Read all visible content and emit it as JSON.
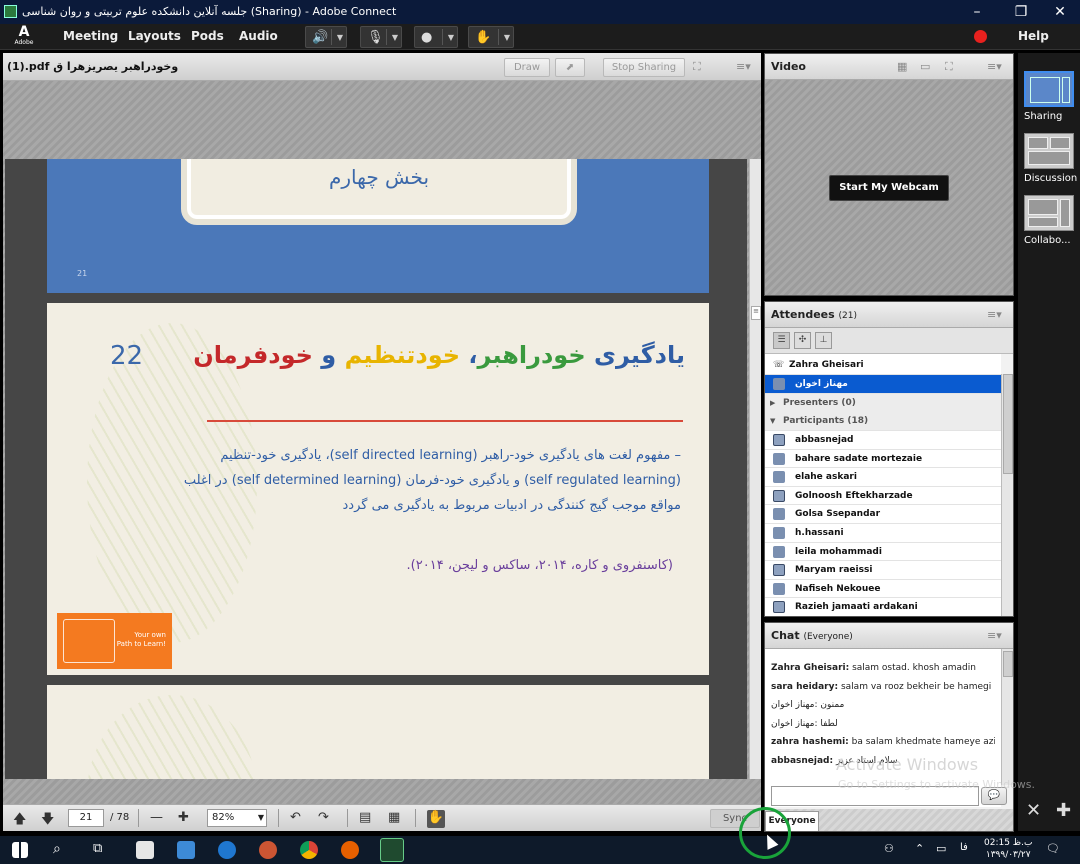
{
  "window": {
    "title": "جلسه آنلاین دانشکده علوم تربیتی و روان شناسی (Sharing) - Adobe Connect",
    "minimize": "–",
    "maximize": "❐",
    "close": "✕"
  },
  "menubar": {
    "logo_text": "Adobe",
    "items": [
      "Meeting",
      "Layouts",
      "Pods",
      "Audio"
    ],
    "help": "Help"
  },
  "share_pod": {
    "filename": "(1).pdf وخودراهبر یصریزهرا ق",
    "draw_button": "Draw",
    "stop_sharing_button": "Stop Sharing",
    "slide21": {
      "title": "بخش چهارم",
      "page_number": "21"
    },
    "slide22": {
      "number": "22",
      "title_parts": [
        {
          "text": "یادگیری ",
          "color": "#2f5da5"
        },
        {
          "text": "خودراهبر",
          "color": "#3a9a3e"
        },
        {
          "text": "، ",
          "color": "#2f5da5"
        },
        {
          "text": "خودتنظیم",
          "color": "#e8b400"
        },
        {
          "text": " و ",
          "color": "#2f5da5"
        },
        {
          "text": "خودفرمان",
          "color": "#c4282a"
        }
      ],
      "body_line1": "– مفهوم لغت های یادگیری خود-راهبر (self directed learning)، یادگیری خود-تنظیم",
      "body_line2": "(self regulated learning) و یادگیری خود-فرمان (self determined learning) در اغلب",
      "body_line3": "مواقع موجب گیج کنندگی در ادبیات مربوط به یادگیری می گردد",
      "citation": "(کاسنفروی و کاره، ۲۰۱۴، ساکس و لیجن، ۲۰۱۴).",
      "badge_line1": "Your own",
      "badge_line2": "Path to Learn!"
    },
    "toolbar": {
      "current_page": "21",
      "total_pages": "/ 78",
      "zoom": "82%",
      "sync_button": "Sync"
    }
  },
  "video_pod": {
    "title": "Video",
    "start_webcam_button": "Start My Webcam"
  },
  "attendees_pod": {
    "title": "Attendees",
    "count": "(21)",
    "host": "Zahra Gheisari",
    "selected": "مهناز اخوان",
    "presenters_label": "Presenters (0)",
    "participants_label": "Participants (18)",
    "participants": [
      "abbasnejad",
      "bahare sadate mortezaie",
      "elahe askari",
      "Golnoosh Eftekharzade",
      "Golsa Ssepandar",
      "h.hassani",
      "leila mohammadi",
      "Maryam raeissi",
      "Nafiseh Nekouee",
      "Razieh jamaati ardakani"
    ]
  },
  "chat_pod": {
    "title": "Chat",
    "scope": "(Everyone)",
    "messages": [
      {
        "from": "Zahra Gheisari:",
        "text": "salam ostad. khosh amadin"
      },
      {
        "from": "sara heidary:",
        "text": "salam va rooz bekheir be hamegi"
      },
      {
        "from": "",
        "text": "ممنون :مهناز اخوان"
      },
      {
        "from": "",
        "text": "لطفا :مهناز اخوان"
      },
      {
        "from": "zahra hashemi:",
        "text": "ba salam khedmate hameye azizan"
      },
      {
        "from": "abbasnejad:",
        "text": "سلام استاد عزیز"
      }
    ],
    "tab_label": "Everyone"
  },
  "layouts_bar": {
    "items": [
      "Sharing",
      "Discussion",
      "Collabo..."
    ]
  },
  "watermark": {
    "line1": "Activate Windows",
    "line2": "Go to Settings to activate Windows."
  },
  "taskbar": {
    "time": "ب.ظ 02:15",
    "date": "۱۳۹۹/۰۳/۲۷",
    "lang": "فا"
  }
}
